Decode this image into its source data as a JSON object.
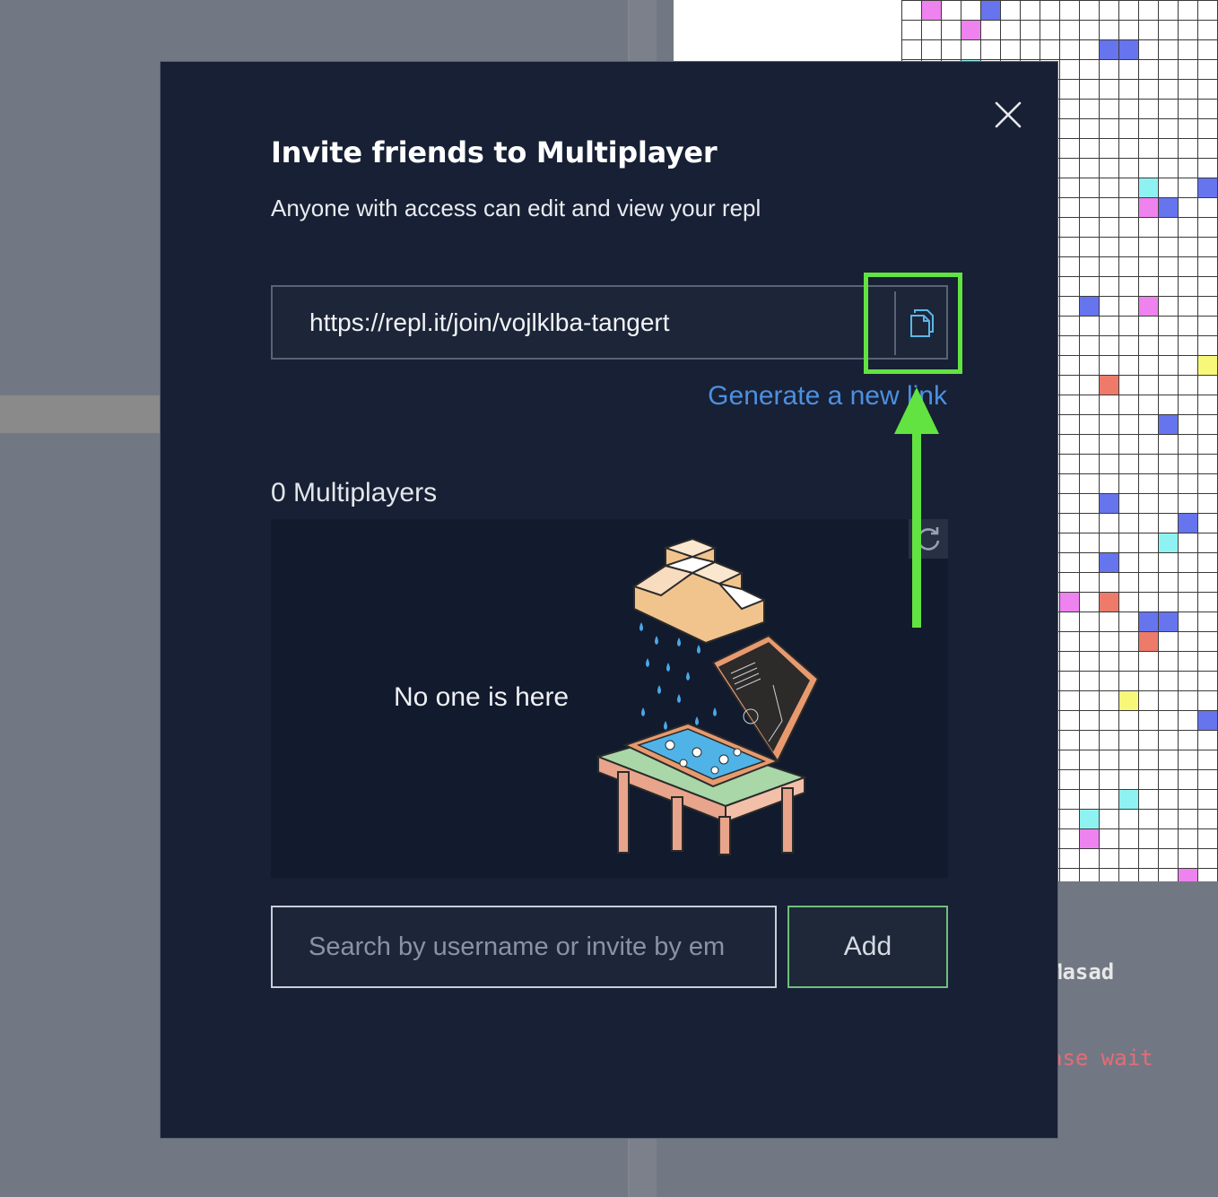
{
  "background": {
    "console_line_1": "Masad",
    "console_line_2": "ase wait"
  },
  "modal": {
    "title": "Invite friends to Multiplayer",
    "subtitle": "Anyone with access can edit and view your repl",
    "invite_link": "https://repl.it/join/vojlklba-tangert",
    "copy_icon": "copy-icon",
    "generate_link_label": "Generate a new link",
    "players_label": "0 Multiplayers",
    "refresh_icon": "refresh-icon",
    "empty_message": "No one is here",
    "search_placeholder": "Search by username or invite by em",
    "add_label": "Add",
    "close_icon": "close-icon"
  },
  "colors": {
    "modal_bg": "#172034",
    "link_blue": "#4d8fe0",
    "annotation_green": "#62e341",
    "add_border": "#6fbf7a"
  }
}
